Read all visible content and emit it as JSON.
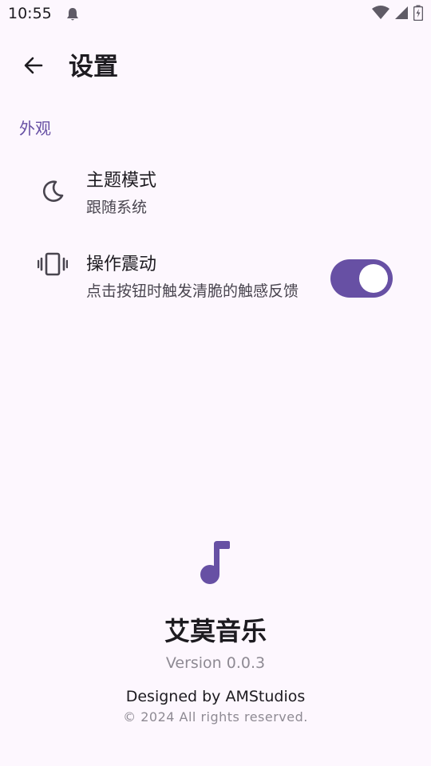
{
  "status_bar": {
    "time": "10:55",
    "notification_icon": "notification-bell-icon",
    "icons": [
      "wifi-icon",
      "signal-icon",
      "battery-charging-icon"
    ]
  },
  "app_bar": {
    "back_icon": "arrow-back-icon",
    "title": "设置"
  },
  "section": {
    "title": "外观"
  },
  "settings": [
    {
      "icon": "moon-icon",
      "title": "主题模式",
      "subtitle": "跟随系统"
    },
    {
      "icon": "vibration-icon",
      "title": "操作震动",
      "subtitle": "点击按钮时触发清脆的触感反馈",
      "toggle_on": true
    }
  ],
  "about": {
    "icon": "music-note-icon",
    "app_name": "艾莫音乐",
    "version": "Version 0.0.3",
    "designed_by": "Designed by AMStudios",
    "copyright": "© 2024 All rights reserved."
  },
  "colors": {
    "background": "#fdf7fe",
    "accent": "#6750a4",
    "text_primary": "#1d1b20",
    "text_secondary": "#49454f",
    "text_muted": "#8e8a93"
  }
}
